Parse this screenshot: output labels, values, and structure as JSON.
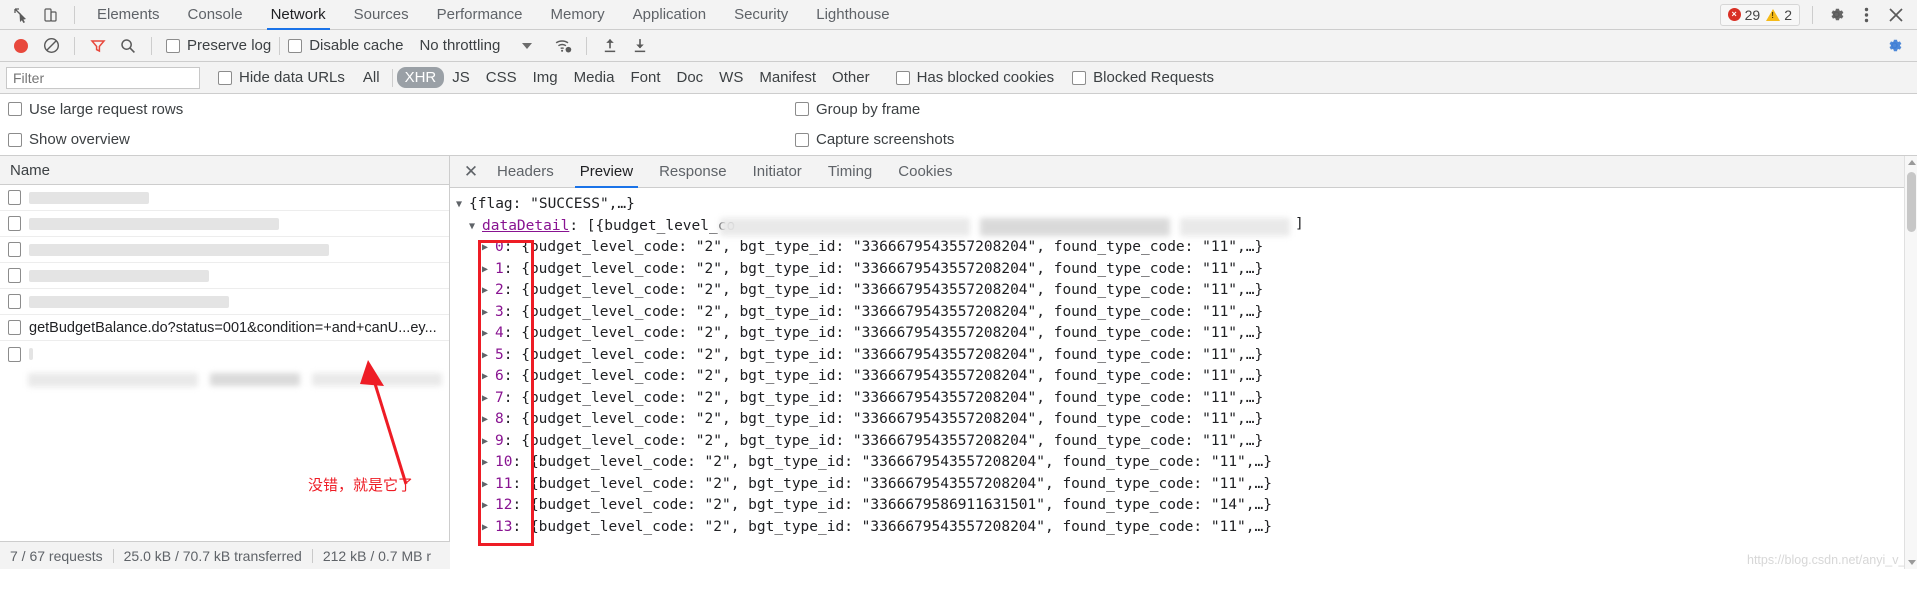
{
  "main_tabs": [
    {
      "label": "Elements",
      "active": false
    },
    {
      "label": "Console",
      "active": false
    },
    {
      "label": "Network",
      "active": true
    },
    {
      "label": "Sources",
      "active": false
    },
    {
      "label": "Performance",
      "active": false
    },
    {
      "label": "Memory",
      "active": false
    },
    {
      "label": "Application",
      "active": false
    },
    {
      "label": "Security",
      "active": false
    },
    {
      "label": "Lighthouse",
      "active": false
    }
  ],
  "counters": {
    "error_count": "29",
    "warning_count": "2",
    "error_glyph": "×",
    "warning_glyph": "!"
  },
  "network_toolbar": {
    "record_title": "record-button",
    "clear_title": "clear-button",
    "preserve_log": "Preserve log",
    "disable_cache": "Disable cache",
    "throttling": "No throttling"
  },
  "filter_bar": {
    "filter_placeholder": "Filter",
    "filter_value": "",
    "hide_data_urls": "Hide data URLs",
    "types": [
      {
        "label": "All",
        "selected": false
      },
      {
        "label": "XHR",
        "selected": true
      },
      {
        "label": "JS",
        "selected": false
      },
      {
        "label": "CSS",
        "selected": false
      },
      {
        "label": "Img",
        "selected": false
      },
      {
        "label": "Media",
        "selected": false
      },
      {
        "label": "Font",
        "selected": false
      },
      {
        "label": "Doc",
        "selected": false
      },
      {
        "label": "WS",
        "selected": false
      },
      {
        "label": "Manifest",
        "selected": false
      },
      {
        "label": "Other",
        "selected": false
      }
    ],
    "has_blocked_cookies": "Has blocked cookies",
    "blocked_requests": "Blocked Requests"
  },
  "settings": {
    "use_large_request_rows": "Use large request rows",
    "group_by_frame": "Group by frame",
    "show_overview": "Show overview",
    "capture_screenshots": "Capture screenshots"
  },
  "requests_panel": {
    "column_header": "Name",
    "selected_request": "getBudgetBalance.do?status=001&condition=+and+canU...ey..."
  },
  "status_bar": {
    "requests": "7 / 67 requests",
    "transferred": "25.0 kB / 70.7 kB transferred",
    "resources": "212 kB / 0.7 MB r"
  },
  "detail_tabs": [
    {
      "label": "Headers",
      "active": false
    },
    {
      "label": "Preview",
      "active": true
    },
    {
      "label": "Response",
      "active": false
    },
    {
      "label": "Initiator",
      "active": false
    },
    {
      "label": "Timing",
      "active": false
    },
    {
      "label": "Cookies",
      "active": false
    }
  ],
  "preview": {
    "root_line": "{flag: \"SUCCESS\",…}",
    "data_detail_key": "dataDetail",
    "data_detail_value": "[{budget_level_co",
    "bracket_right": "]",
    "rows": [
      {
        "index": "0",
        "body": "{budget_level_code: \"2\", bgt_type_id: \"3366679543557208204\", found_type_code: \"11\",…}"
      },
      {
        "index": "1",
        "body": "{budget_level_code: \"2\", bgt_type_id: \"3366679543557208204\", found_type_code: \"11\",…}"
      },
      {
        "index": "2",
        "body": "{budget_level_code: \"2\", bgt_type_id: \"3366679543557208204\", found_type_code: \"11\",…}"
      },
      {
        "index": "3",
        "body": "{budget_level_code: \"2\", bgt_type_id: \"3366679543557208204\", found_type_code: \"11\",…}"
      },
      {
        "index": "4",
        "body": "{budget_level_code: \"2\", bgt_type_id: \"3366679543557208204\", found_type_code: \"11\",…}"
      },
      {
        "index": "5",
        "body": "{budget_level_code: \"2\", bgt_type_id: \"3366679543557208204\", found_type_code: \"11\",…}"
      },
      {
        "index": "6",
        "body": "{budget_level_code: \"2\", bgt_type_id: \"3366679543557208204\", found_type_code: \"11\",…}"
      },
      {
        "index": "7",
        "body": "{budget_level_code: \"2\", bgt_type_id: \"3366679543557208204\", found_type_code: \"11\",…}"
      },
      {
        "index": "8",
        "body": "{budget_level_code: \"2\", bgt_type_id: \"3366679543557208204\", found_type_code: \"11\",…}"
      },
      {
        "index": "9",
        "body": "{budget_level_code: \"2\", bgt_type_id: \"3366679543557208204\", found_type_code: \"11\",…}"
      },
      {
        "index": "10",
        "body": "{budget_level_code: \"2\", bgt_type_id: \"3366679543557208204\", found_type_code: \"11\",…}"
      },
      {
        "index": "11",
        "body": "{budget_level_code: \"2\", bgt_type_id: \"3366679543557208204\", found_type_code: \"11\",…}"
      },
      {
        "index": "12",
        "body": "{budget_level_code: \"2\", bgt_type_id: \"3366679586911631501\", found_type_code: \"14\",…}"
      },
      {
        "index": "13",
        "body": "{budget_level_code: \"2\", bgt_type_id: \"3366679543557208204\", found_type_code: \"11\",…}"
      }
    ]
  },
  "annotation": {
    "note_text": "没错，就是它了",
    "color": "#ee1c25"
  },
  "watermark": {
    "text": "https://blog.csdn.net/anyi_v_ji"
  },
  "colors": {
    "accent": "#1a73e8",
    "error": "#d93025",
    "warning": "#f5ba19",
    "annotation": "#ee1c25",
    "json_string": "#c41a16",
    "json_key": "#881391",
    "toolbar_bg": "#f3f3f3"
  }
}
